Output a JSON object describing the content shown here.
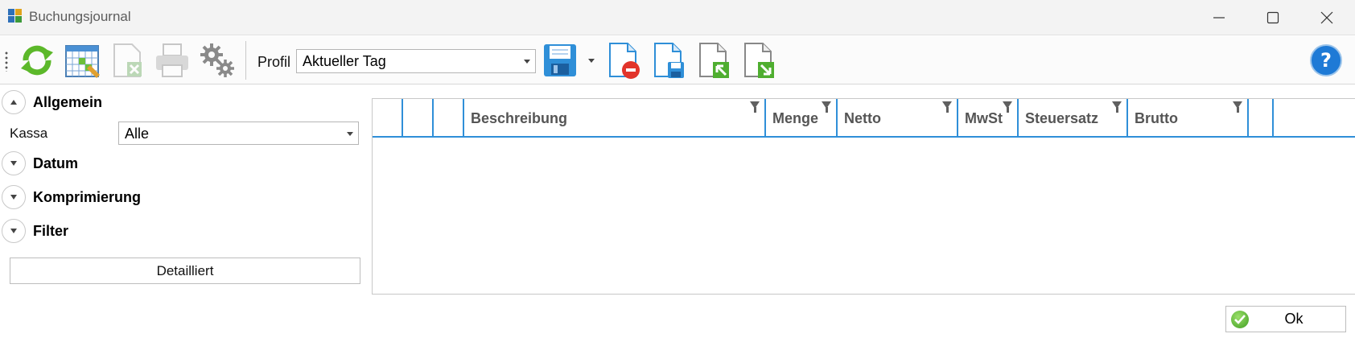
{
  "window": {
    "title": "Buchungsjournal"
  },
  "toolbar": {
    "items": [
      "refresh-icon",
      "calendar-grid-icon",
      "export-disabled-icon",
      "print-icon",
      "settings-gears-icon",
      "save-icon",
      "delete-document-icon",
      "save-document-icon",
      "import-document-icon",
      "export-document-icon",
      "help-icon"
    ],
    "profile_label": "Profil",
    "profile_value": "Aktueller Tag"
  },
  "sidebar": {
    "allgemein": "Allgemein",
    "kassa_label": "Kassa",
    "kassa_value": "Alle",
    "datum": "Datum",
    "komprimierung": "Komprimierung",
    "filter": "Filter",
    "detail_button": "Detailliert"
  },
  "grid": {
    "columns": [
      "",
      "",
      "",
      "Beschreibung",
      "Menge",
      "Netto",
      "MwSt",
      "Steuersatz",
      "Brutto",
      "",
      ""
    ],
    "rows": []
  },
  "footer": {
    "ok_label": "Ok"
  },
  "colors": {
    "accent": "#2f8fd8",
    "refresh": "#5cb82a",
    "help": "#1e7ad6"
  }
}
